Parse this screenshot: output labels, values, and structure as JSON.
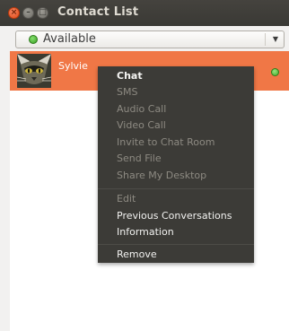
{
  "window": {
    "title": "Contact List",
    "buttons": {
      "close_glyph": "×",
      "minimize_glyph": "–",
      "maximize_glyph": "□"
    }
  },
  "status": {
    "label": "Available",
    "indicator_color": "#3a9f22",
    "dropdown_glyph": "▼"
  },
  "contacts": [
    {
      "name": "Sylvie",
      "presence_color": "#46a829",
      "avatar": "cat-avatar-icon"
    }
  ],
  "context_menu": {
    "items": [
      {
        "label": "Chat",
        "enabled": true
      },
      {
        "label": "SMS",
        "enabled": false
      },
      {
        "label": "Audio Call",
        "enabled": false
      },
      {
        "label": "Video Call",
        "enabled": false
      },
      {
        "label": "Invite to Chat Room",
        "enabled": false
      },
      {
        "label": "Send File",
        "enabled": false
      },
      {
        "label": "Share My Desktop",
        "enabled": false
      },
      {
        "label": "Edit",
        "enabled": false
      },
      {
        "label": "Previous Conversations",
        "enabled": true
      },
      {
        "label": "Information",
        "enabled": true
      },
      {
        "label": "Remove",
        "enabled": true
      }
    ]
  },
  "colors": {
    "selection": "#f07746",
    "menu_background": "#3c3b37",
    "titlebar": "#3c3b37"
  }
}
